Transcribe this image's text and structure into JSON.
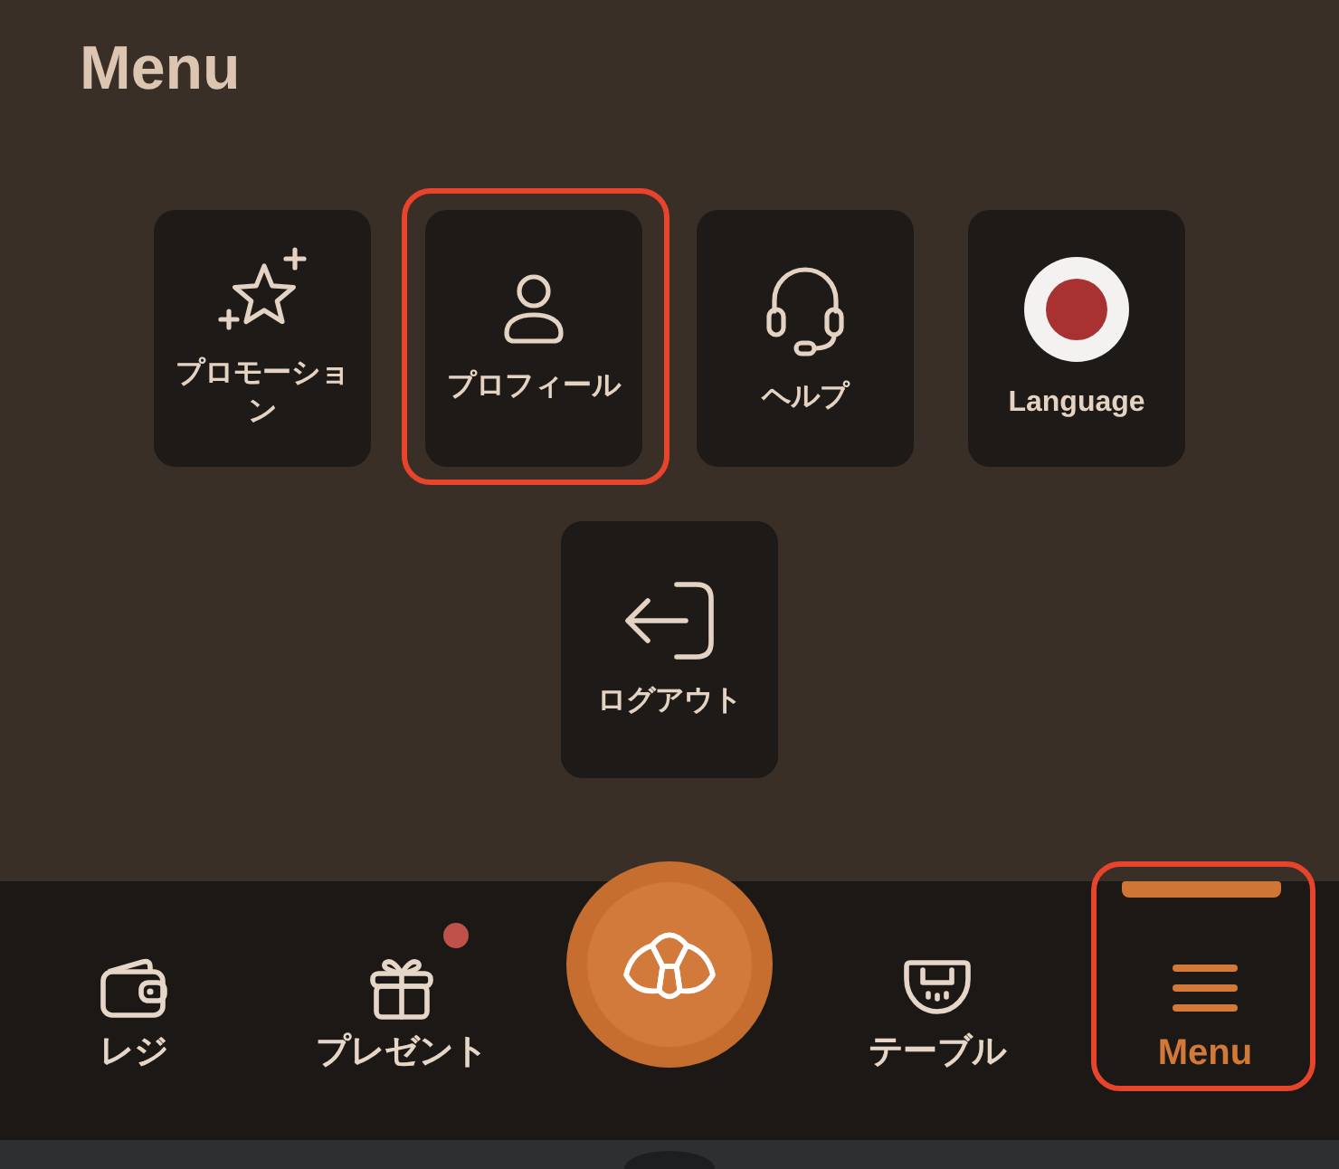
{
  "page": {
    "title": "Menu"
  },
  "tiles": [
    {
      "label": "プロモーション",
      "highlighted": false
    },
    {
      "label": "プロフィール",
      "highlighted": true
    },
    {
      "label": "ヘルプ",
      "highlighted": false
    },
    {
      "label": "Language",
      "highlighted": false
    },
    {
      "label": "ログアウト",
      "highlighted": false
    }
  ],
  "bottom_nav": {
    "items": [
      {
        "kind": "tab",
        "label": "レジ",
        "selected": false,
        "badge": false,
        "highlighted": false
      },
      {
        "kind": "tab",
        "label": "プレゼント",
        "selected": false,
        "badge": true,
        "highlighted": false
      },
      {
        "kind": "action"
      },
      {
        "kind": "tab",
        "label": "テーブル",
        "selected": false,
        "badge": false,
        "highlighted": false
      },
      {
        "kind": "tab",
        "label": "Menu",
        "selected": true,
        "badge": false,
        "highlighted": true
      }
    ]
  }
}
